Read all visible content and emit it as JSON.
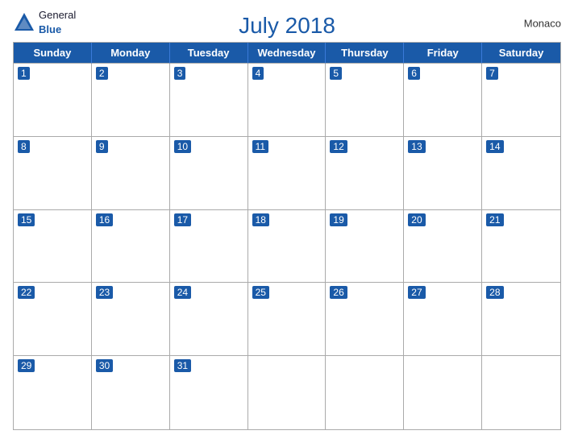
{
  "header": {
    "logo_general": "General",
    "logo_blue": "Blue",
    "title": "July 2018",
    "country": "Monaco"
  },
  "days_of_week": [
    "Sunday",
    "Monday",
    "Tuesday",
    "Wednesday",
    "Thursday",
    "Friday",
    "Saturday"
  ],
  "weeks": [
    [
      1,
      2,
      3,
      4,
      5,
      6,
      7
    ],
    [
      8,
      9,
      10,
      11,
      12,
      13,
      14
    ],
    [
      15,
      16,
      17,
      18,
      19,
      20,
      21
    ],
    [
      22,
      23,
      24,
      25,
      26,
      27,
      28
    ],
    [
      29,
      30,
      31,
      null,
      null,
      null,
      null
    ]
  ]
}
